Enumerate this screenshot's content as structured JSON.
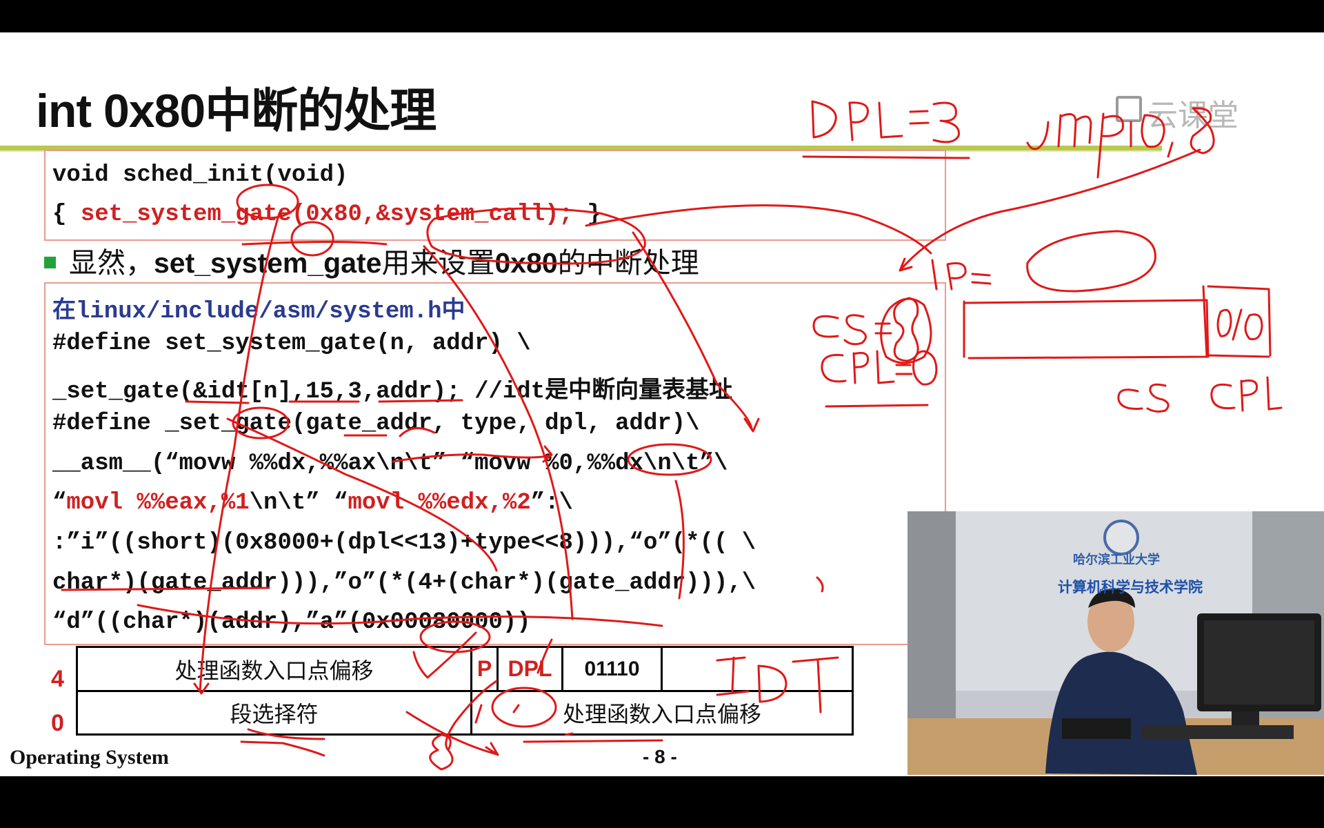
{
  "slide": {
    "title": "int 0x80中断的处理",
    "code1": {
      "line1": "void sched_init(void)",
      "line2_open": "{ ",
      "line2_red": "set_system_gate(0x80,&system_call);",
      "line2_close": " }"
    },
    "bullet": {
      "prefix": "显然，",
      "bold1": "set_system_gate",
      "mid": "用来设置",
      "bold2": "0x80",
      "suffix": "的中断处理"
    },
    "code2": {
      "header_prefix": "在",
      "header_path": "linux/include/asm/system.h",
      "header_suffix": "中",
      "lines": [
        "#define set_system_gate(n, addr) \\",
        "_set_gate(&idt[n],15,3,addr); //idt是中断向量表基址",
        "#define _set_gate(gate_addr, type, dpl, addr)\\",
        "__asm__(“movw %%dx,%%ax\\n\\t” “movw %0,%%dx\\n\\t”\\",
        ":”i”((short)(0x8000+(dpl<<13)+type<<8))),“o”(*(( \\",
        "char*)(gate_addr))),”o”(*(4+(char*)(gate_addr))),\\",
        "“d”((char*)(addr),”a”(0x00080000))"
      ],
      "red_line": {
        "q1": "“",
        "r1": "movl %%eax,%1",
        "m1": "\\n\\t” “",
        "r2": "movl %%edx,%2",
        "end": "”:\\"
      }
    },
    "table": {
      "row_labels": [
        "4",
        "0"
      ],
      "row4": {
        "offset_label": "处理函数入口点偏移",
        "p": "P",
        "dpl": "DPL",
        "type_bits": "01110",
        "empty": ""
      },
      "row0": {
        "selector": "段选择符",
        "offset_label": "处理函数入口点偏移"
      }
    },
    "footer": {
      "left": "Operating System",
      "page": "- 8 -"
    },
    "watermark": "云课堂"
  },
  "annotations": {
    "handwritten": [
      "DPL=3",
      "jmpi 0,8",
      "CS=8",
      "CPL=0",
      "IP=",
      "0/0",
      "CS",
      "CPL",
      "IDT",
      "8"
    ],
    "ink_color": "#e01818"
  },
  "video": {
    "banner_text": "计算机科学与技术学院",
    "school_text": "哈尔滨工业大学"
  }
}
